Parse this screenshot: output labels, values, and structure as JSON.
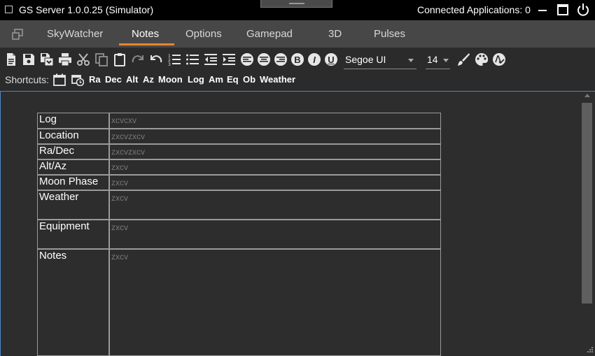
{
  "window": {
    "title": "GS Server 1.0.0.25 (Simulator)",
    "connected_label": "Connected Applications: 0",
    "icons": [
      "checkbox",
      "minimize-icon",
      "maximize-icon",
      "power-icon"
    ]
  },
  "tabs": [
    {
      "label": "SkyWatcher"
    },
    {
      "label": "Notes",
      "active": true
    },
    {
      "label": "Options"
    },
    {
      "label": "Gamepad"
    },
    {
      "label": "3D"
    },
    {
      "label": "Pulses"
    }
  ],
  "toolbar": {
    "font": "Segoe UI",
    "size": "14",
    "buttons": [
      "new-document",
      "save",
      "save-as",
      "print",
      "cut",
      "copy",
      "paste",
      "redo",
      "undo",
      "numbered-list",
      "bullet-list",
      "decrease-indent",
      "increase-indent",
      "align-left",
      "align-center",
      "align-right",
      "bold",
      "italic",
      "underline",
      "brush",
      "palette",
      "spell-check"
    ],
    "bold_glyph": "B",
    "italic_glyph": "I",
    "underline_glyph": "U"
  },
  "shortcuts": {
    "label": "Shortcuts:",
    "items": [
      "Ra",
      "Dec",
      "Alt",
      "Az",
      "Moon",
      "Log",
      "Am",
      "Eq",
      "Ob",
      "Weather"
    ]
  },
  "notes_table": [
    {
      "label": "Log",
      "value": "xcvcxv"
    },
    {
      "label": "Location",
      "value": "zxcvzxcv"
    },
    {
      "label": "Ra/Dec",
      "value": "zxcvzxcv"
    },
    {
      "label": "Alt/Az",
      "value": "zxcv"
    },
    {
      "label": "Moon Phase",
      "value": "zxcv"
    },
    {
      "label": "Weather",
      "value": "zxcv"
    },
    {
      "label": "Equipment",
      "value": "zxcv"
    },
    {
      "label": "Notes",
      "value": "zxcv"
    }
  ],
  "colors": {
    "tab_active_underline": "#e8852c",
    "doc_focus_border": "#4f86c6"
  }
}
